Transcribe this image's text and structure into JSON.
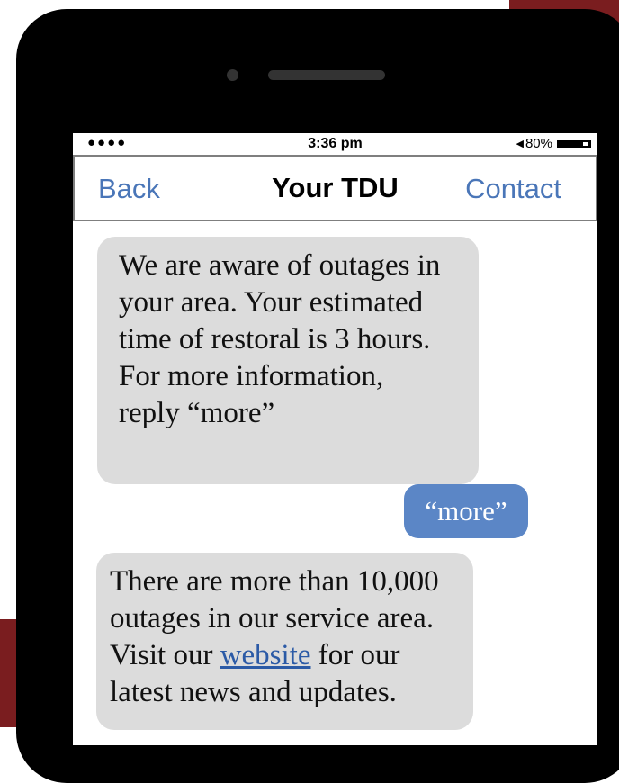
{
  "status_bar": {
    "signal": "●●●●",
    "time": "3:36 pm",
    "location_icon": "location-arrow-icon",
    "battery_percent": "80%",
    "battery_level": 0.8
  },
  "nav": {
    "back_label": "Back",
    "title": "Your TDU",
    "contact_label": "Contact"
  },
  "messages": [
    {
      "direction": "received",
      "lines": [
        "We are aware of outages in",
        "your area. Your estimated",
        "time of restoral is 3 hours.",
        "For more information,",
        "reply “more”"
      ]
    },
    {
      "direction": "sent",
      "text": "“more”"
    },
    {
      "direction": "received",
      "line1": "There are more than 10,000",
      "line2": "outages in our service area.",
      "line3_before": "Visit our ",
      "link_text": "website",
      "line3_after": " for our",
      "line4": "latest news and updates."
    }
  ],
  "colors": {
    "accent": "#7a1d1f",
    "link": "#4a76b8",
    "sent_bubble": "#5b86c6",
    "received_bubble": "#dcdcdc"
  }
}
